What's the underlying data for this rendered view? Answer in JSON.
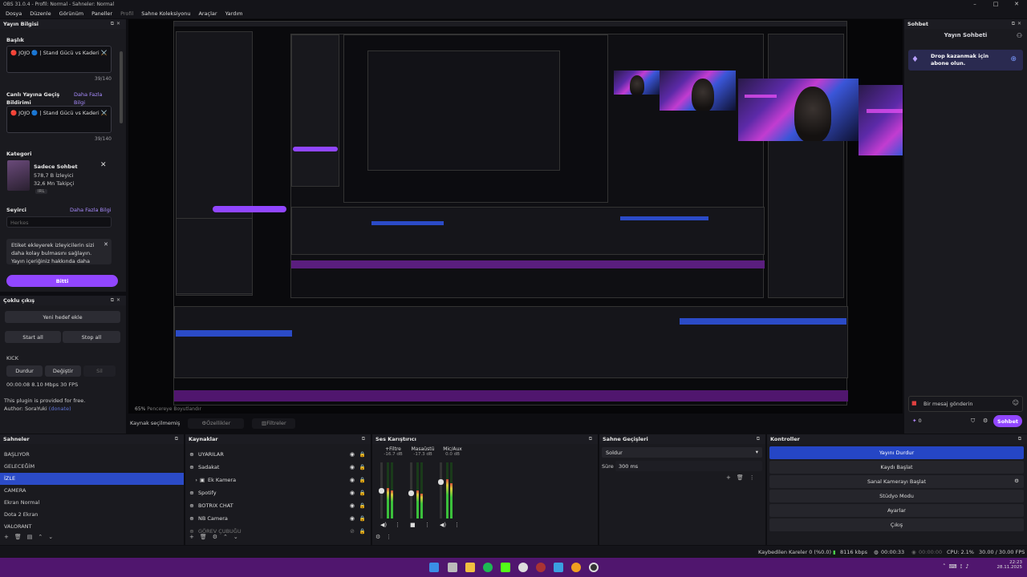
{
  "window": {
    "title": "OBS 31.0.4 - Profil: Normal - Sahneler: Normal"
  },
  "menu": [
    "Dosya",
    "Düzenle",
    "Görünüm",
    "Paneller",
    "Profil",
    "Sahne Koleksiyonu",
    "Araçlar",
    "Yardım"
  ],
  "stream_info": {
    "header": "Yayın Bilgisi",
    "title_label": "Başlık",
    "title_value": "🔴 JOJO 🔵 | Stand Gücü vs Kaderi ⚔️",
    "title_count": "39/140",
    "go_live_label": "Canlı Yayına Geçiş Bildirimi",
    "learn_more": "Daha Fazla Bilgi",
    "go_live_value": "🔴 JOJO 🔵 | Stand Gücü vs Kaderi ⚔️",
    "go_live_count": "39/140",
    "category_label": "Kategori",
    "category_name": "Sadece Sohbet",
    "category_viewers": "578,7 B İzleyici",
    "category_followers": "32,6 Mn Takipçi",
    "category_tag": "IRL",
    "audience_label": "Seyirci",
    "audience_link": "Daha Fazla Bilgi",
    "audience_placeholder": "Herkes",
    "tags_notice": "Etiket ekleyerek izleyicilerin sizi daha kolay bulmasını sağlayın. Yayın içeriğiniz hakkında daha",
    "done_button": "Bitti"
  },
  "multistream": {
    "header": "Çoklu çıkış",
    "new_target": "Yeni hedef ekle",
    "start_all": "Start all",
    "stop_all": "Stop all",
    "kick_label": "KICK",
    "stop_btn": "Durdur",
    "change_btn": "Değiştir",
    "delete_btn": "Sil",
    "stats": "00:00:08  8.10 Mbps  30 FPS",
    "footer_line1": "This plugin is provided for free.",
    "footer_line2": "Author: SoraYuki",
    "footer_link": "(donate)"
  },
  "preview": {
    "zoom": "65%",
    "fit_label": "Pencereye Boyutlandır"
  },
  "source_toolbar": {
    "no_source": "Kaynak seçilmemiş",
    "properties": "Özellikler",
    "filters": "Filtreler"
  },
  "scenes": {
    "header": "Sahneler",
    "items": [
      "BAŞLIYOR",
      "GELECEĞİM",
      "İZLE",
      "CAMERA",
      "Ekran Normal",
      "Dota 2 Ekran",
      "VALORANT"
    ],
    "selected_index": 2
  },
  "sources": {
    "header": "Kaynaklar",
    "items": [
      {
        "name": "UYARILAR",
        "icon": "globe-icon"
      },
      {
        "name": "Sadakat",
        "icon": "globe-icon"
      },
      {
        "name": "Ek Kamera",
        "icon": "folder-icon"
      },
      {
        "name": "Spotify",
        "icon": "globe-icon"
      },
      {
        "name": "BOTRIX CHAT",
        "icon": "globe-icon"
      },
      {
        "name": "NB Camera",
        "icon": "globe-icon"
      },
      {
        "name": "GÖREV ÇUBUĞU",
        "icon": "globe-icon"
      }
    ]
  },
  "mixer": {
    "header": "Ses Karıştırıcı",
    "channels": [
      {
        "name": "+Filtre",
        "db": "-16.7 dB",
        "level": 0.55
      },
      {
        "name": "Masaüstü",
        "db": "-17.3 dB",
        "level": 0.5
      },
      {
        "name": "Mic/Aux",
        "db": "0.0 dB",
        "level": 0.7
      }
    ]
  },
  "transitions": {
    "header": "Sahne Geçişleri",
    "selected": "Soldur",
    "duration_label": "Süre",
    "duration_value": "300 ms"
  },
  "controls": {
    "header": "Kontroller",
    "buttons": [
      "Yayını Durdur",
      "Kaydı Başlat",
      "Sanal Kamerayı Başlat",
      "Stüdyo Modu",
      "Ayarlar",
      "Çıkış"
    ]
  },
  "chat": {
    "header": "Sohbet",
    "title": "Yayın Sohbeti",
    "drop_text": "Drop kazanmak için abone olun.",
    "input_placeholder": "Bir mesaj gönderin",
    "count": "0",
    "send": "Sohbet"
  },
  "statusbar": {
    "dropped": "Kaybedilen Kareler 0 (%0.0)",
    "bitrate": "8116 kbps",
    "stream_time": "00:00:33",
    "rec_time": "00:00:00",
    "cpu": "CPU: 2.1%",
    "fps": "30.00 / 30.00 FPS"
  },
  "taskbar": {
    "time": "22:23",
    "date": "28.11.2025",
    "colors": {
      "bar": "#50166e",
      "accent": "#9146ff",
      "selected": "#2b4bc7"
    }
  }
}
